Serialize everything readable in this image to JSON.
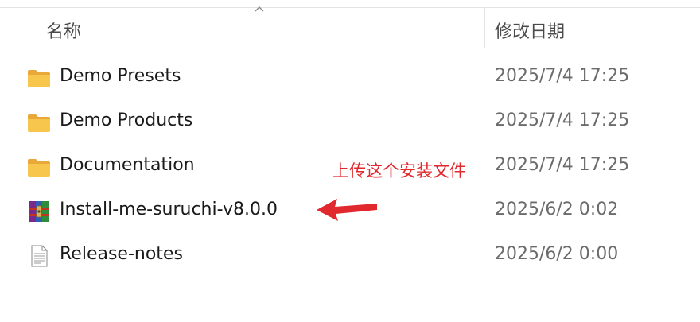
{
  "header": {
    "name_label": "名称",
    "date_label": "修改日期"
  },
  "files": [
    {
      "name": "Demo Presets",
      "date": "2025/7/4 17:25",
      "icon": "folder-icon"
    },
    {
      "name": "Demo Products",
      "date": "2025/7/4 17:25",
      "icon": "folder-icon"
    },
    {
      "name": "Documentation",
      "date": "2025/7/4 17:25",
      "icon": "folder-icon"
    },
    {
      "name": "Install-me-suruchi-v8.0.0",
      "date": "2025/6/2 0:02",
      "icon": "winrar-archive-icon"
    },
    {
      "name": "Release-notes",
      "date": "2025/6/2 0:00",
      "icon": "text-document-icon"
    }
  ],
  "annotation": {
    "text": "上传这个安装文件",
    "color": "#e0282e"
  }
}
